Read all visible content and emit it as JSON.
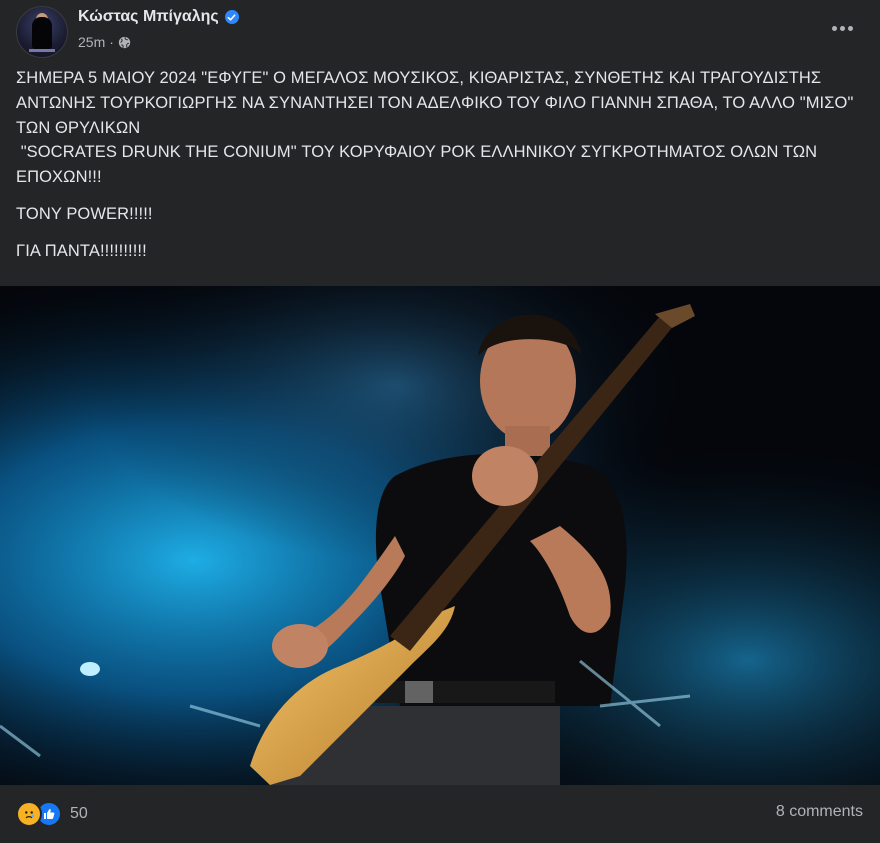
{
  "post": {
    "author": "Κώστας Μπίγαλης",
    "time": "25m",
    "privacy_icon": "globe-icon",
    "verified_icon": "verified-badge-icon",
    "more_icon": "more-options-icon",
    "body": [
      "ΣΗΜΕΡΑ 5 ΜΑΙΟΥ 2024 \"ΕΦΥΓΕ\" Ο ΜΕΓΑΛΟΣ ΜΟΥΣΙΚΟΣ, ΚΙΘΑΡΙΣΤΑΣ, ΣΥΝΘΕΤΗΣ ΚΑΙ ΤΡΑΓΟΥΔΙΣΤΗΣ ΑΝΤΩΝΗΣ ΤΟΥΡΚΟΓΙΩΡΓΗΣ ΝΑ ΣΥΝΑΝΤΗΣΕΙ ΤΟΝ ΑΔΕΛΦΙΚΟ ΤΟΥ ΦΙΛΟ ΓΙΑΝΝΗ ΣΠΑΘΑ, ΤΟ ΑΛΛΟ \"ΜΙΣΟ\" ΤΩΝ ΘΡΥΛΙΚΩΝ\n \"SOCRATES DRUNK THE CONIUM\" ΤΟΥ ΚΟΡΥΦΑΙΟΥ ΡΟΚ ΕΛΛΗΝΙΚΟΥ ΣΥΓΚΡΟΤΗΜΑΤΟΣ ΟΛΩΝ ΤΩΝ ΕΠΟΧΩΝ!!!",
      "TONY POWER!!!!!",
      "ΓΙΑ ΠΑΝΤΑ!!!!!!!!!!"
    ]
  },
  "footer": {
    "reaction_icons": [
      "sad-reaction-icon",
      "like-reaction-icon"
    ],
    "reaction_count": "50",
    "comments": "8 comments"
  },
  "colors": {
    "background": "#242526",
    "text": "#e4e6eb",
    "secondary_text": "#b0b3b8",
    "verified_blue": "#2d88ff"
  }
}
